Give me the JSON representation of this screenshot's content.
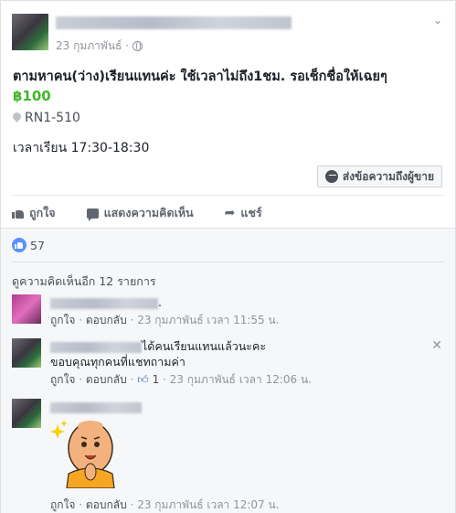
{
  "post": {
    "timestamp": "23 กุมภาพันธ์ ·",
    "title": "ตามหาคน(ว่าง)เรียนแทนค่ะ ใช้เวลาไม่ถึง1ชม. รอเช็กชื่อให้เฉยๆ",
    "price": "฿100",
    "location": "RN1-510",
    "description": "เวลาเรียน 17:30-18:30",
    "message_button_label": "ส่งข้อความถึงผู้ขาย"
  },
  "actions": {
    "like_label": "ถูกใจ",
    "comment_label": "แสดงความคิดเห็น",
    "share_label": "แชร์"
  },
  "reactions": {
    "like_count": "57"
  },
  "comments_section": {
    "view_more": "ดูความคิดเห็นอีก 12 รายการ",
    "items": [
      {
        "text": ".",
        "like": "ถูกใจ",
        "reply": "ตอบกลับ",
        "time": "23 กุมภาพันธ์ เวลา 11:55 น."
      },
      {
        "text_line1": "ได้คนเรียนแทนแล้วนะคะ",
        "text_line2": "ขอบคุณทุกคนที่แชทถามค่า",
        "like": "ถูกใจ",
        "reply": "ตอบกลับ",
        "like_count": "1",
        "time": "23 กุมภาพันธ์ เวลา 12:06 น."
      },
      {
        "like": "ถูกใจ",
        "reply": "ตอบกลับ",
        "time": "23 กุมภาพันธ์ เวลา 12:07 น."
      }
    ]
  },
  "icons": {
    "globe": "globe-icon",
    "pin": "location-pin-icon",
    "messenger": "messenger-icon",
    "like": "thumbs-up-icon",
    "comment": "comment-icon",
    "share": "share-arrow-icon",
    "close": "close-icon",
    "chevron": "chevron-down-icon"
  },
  "colors": {
    "price_green": "#42b72a",
    "like_blue": "#5890ff",
    "meta_gray": "#90949c"
  }
}
